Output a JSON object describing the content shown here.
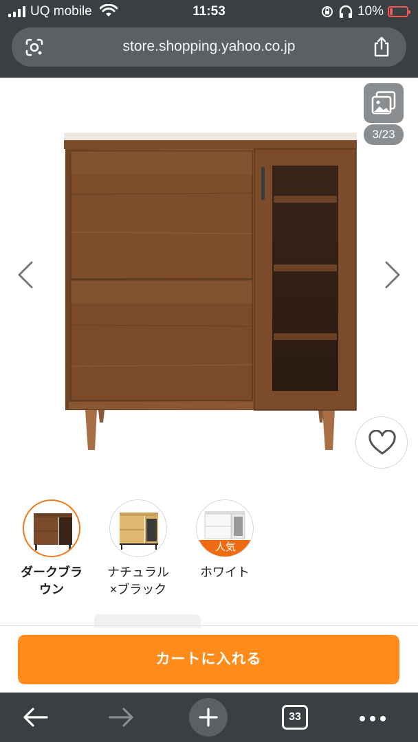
{
  "status_bar": {
    "carrier": "UQ mobile",
    "time": "11:53",
    "battery": "10%"
  },
  "browser": {
    "url": "store.shopping.yahoo.co.jp",
    "tab_count": "33"
  },
  "gallery": {
    "counter": "3/23",
    "product": "Cabinet with two flip-down drawers and a glass door cabinet, dark brown wood finish"
  },
  "variants": [
    {
      "label": "ダークブラ\nウン",
      "selected": true,
      "badge": ""
    },
    {
      "label": "ナチュラル\n×ブラック",
      "selected": false,
      "badge": ""
    },
    {
      "label": "ホワイト",
      "selected": false,
      "badge": "人気"
    }
  ],
  "cart": {
    "label": "カートに入れる"
  },
  "colors": {
    "accent": "#ff8c1a",
    "selected_border": "#f07a1a",
    "browser_chrome": "#3a3f42",
    "wood_dark": "#7a4a2a"
  }
}
